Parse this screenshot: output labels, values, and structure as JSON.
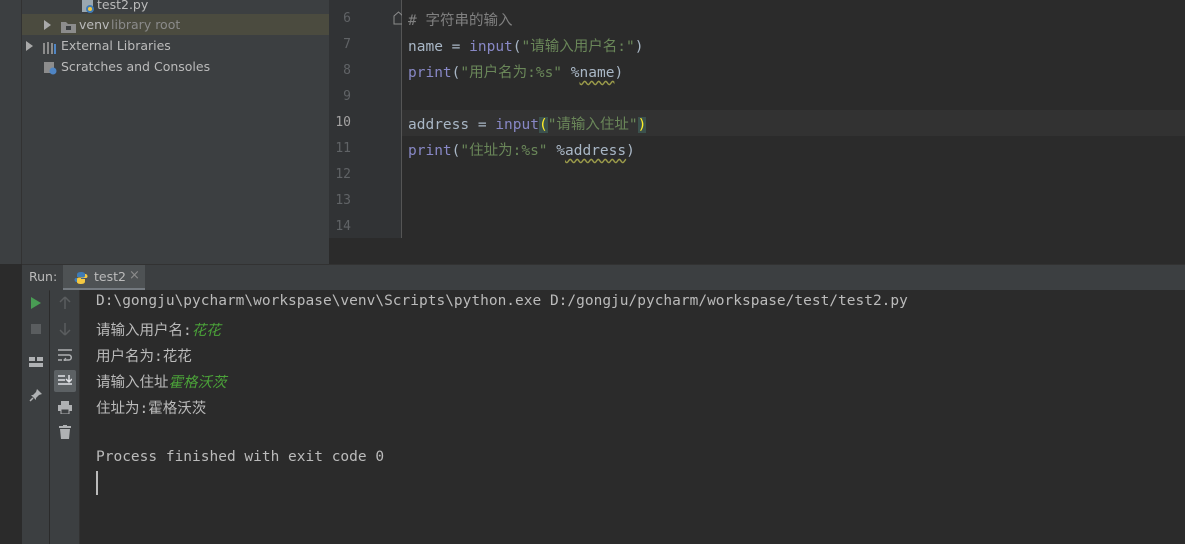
{
  "project_tree": {
    "items": [
      {
        "label": "test2.py",
        "extra": ""
      },
      {
        "label": "venv",
        "extra": "library root"
      },
      {
        "label": "External Libraries",
        "extra": ""
      },
      {
        "label": "Scratches and Consoles",
        "extra": ""
      }
    ]
  },
  "editor": {
    "line_numbers": [
      "6",
      "7",
      "8",
      "9",
      "10",
      "11",
      "12",
      "13",
      "14"
    ],
    "line6": {
      "comment": "# 字符串的输入"
    },
    "line7": {
      "var": "name",
      "op": " = ",
      "func": "input",
      "open": "(",
      "str": "\"请输入用户名:\"",
      "close": ")"
    },
    "line8": {
      "func": "print",
      "open": "(",
      "str": "\"用户名为:%s\"",
      "op": " %",
      "arg": "name",
      "close": ")"
    },
    "line10": {
      "var": "address",
      "op": " = ",
      "func": "input",
      "open": "(",
      "str": "\"请输入住址\"",
      "close": ")"
    },
    "line11": {
      "func": "print",
      "open": "(",
      "str": "\"住址为:%s\"",
      "op": " %",
      "arg": "address",
      "close": ")"
    }
  },
  "run_panel": {
    "label": "Run:",
    "tab": "test2",
    "tab_close": "×"
  },
  "console": {
    "command": "D:\\gongju\\pycharm\\workspase\\venv\\Scripts\\python.exe D:/gongju/pycharm/workspase/test/test2.py",
    "prompt1": "请输入用户名:",
    "input1": "花花",
    "output1": "用户名为:花花",
    "prompt2": "请输入住址",
    "input2": "霍格沃茨",
    "output2": "住址为:霍格沃茨",
    "finish": "Process finished with exit code 0"
  },
  "colors": {
    "background": "#2b2b2b",
    "panel": "#3c3f41",
    "keyword": "#8888c6",
    "string": "#6a8759",
    "user_input": "#4ba339"
  }
}
